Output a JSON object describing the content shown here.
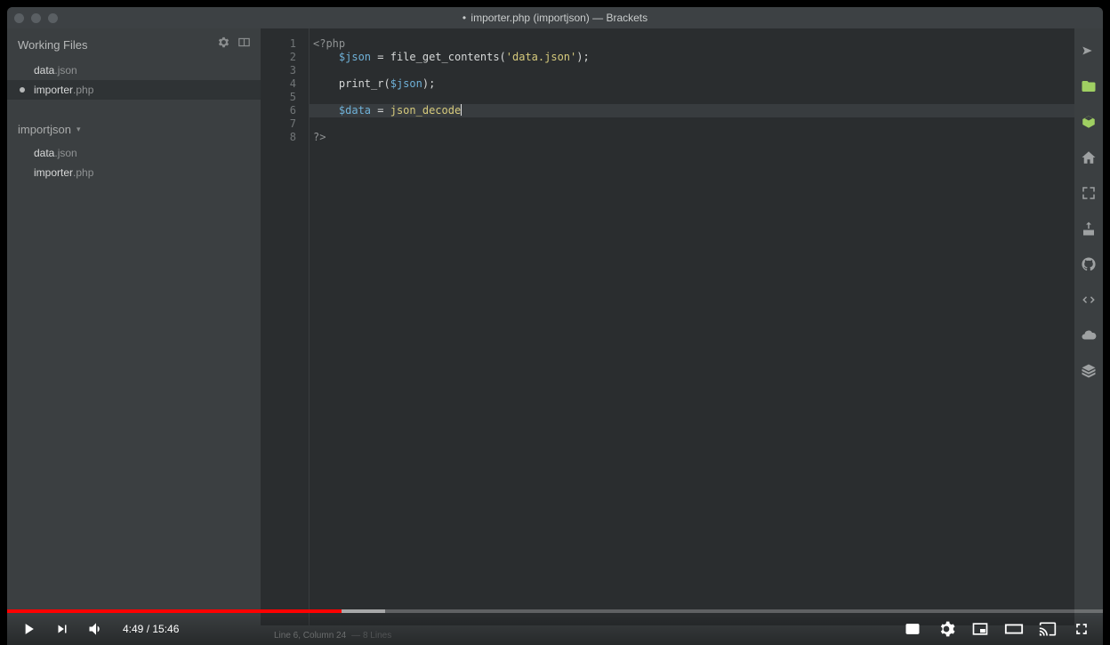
{
  "window": {
    "title_prefix": "•",
    "title": "importer.php (importjson) — Brackets"
  },
  "sidebar": {
    "working_files_label": "Working Files",
    "working_files": [
      {
        "base": "data",
        "ext": ".json",
        "dirty": false,
        "active": false
      },
      {
        "base": "importer",
        "ext": ".php",
        "dirty": true,
        "active": true
      }
    ],
    "project_name": "importjson",
    "project_files": [
      {
        "base": "data",
        "ext": ".json"
      },
      {
        "base": "importer",
        "ext": ".php"
      }
    ]
  },
  "editor": {
    "line_numbers": [
      "1",
      "2",
      "3",
      "4",
      "5",
      "6",
      "7",
      "8"
    ],
    "current_line_index": 5,
    "lines": [
      [
        {
          "c": "tok-tag",
          "t": "<?php"
        }
      ],
      [
        {
          "c": "",
          "t": "    "
        },
        {
          "c": "tok-var",
          "t": "$json"
        },
        {
          "c": "tok-op",
          "t": " = "
        },
        {
          "c": "tok-fn",
          "t": "file_get_contents"
        },
        {
          "c": "tok-op",
          "t": "("
        },
        {
          "c": "tok-str",
          "t": "'data.json'"
        },
        {
          "c": "tok-op",
          "t": ");"
        }
      ],
      [
        {
          "c": "",
          "t": ""
        }
      ],
      [
        {
          "c": "",
          "t": "    "
        },
        {
          "c": "tok-fn",
          "t": "print_r"
        },
        {
          "c": "tok-op",
          "t": "("
        },
        {
          "c": "tok-var",
          "t": "$json"
        },
        {
          "c": "tok-op",
          "t": ");"
        }
      ],
      [
        {
          "c": "",
          "t": ""
        }
      ],
      [
        {
          "c": "",
          "t": "    "
        },
        {
          "c": "tok-var",
          "t": "$data"
        },
        {
          "c": "tok-op",
          "t": " = "
        },
        {
          "c": "tok-kw",
          "t": "json_decode"
        },
        {
          "c": "cursor",
          "t": ""
        }
      ],
      [
        {
          "c": "",
          "t": ""
        }
      ],
      [
        {
          "c": "tok-tag",
          "t": "?>"
        }
      ]
    ]
  },
  "status": {
    "pos": "Line 6, Column 24",
    "lines": "— 8 Lines"
  },
  "video": {
    "current": "4:49",
    "sep": " / ",
    "total": "15:46"
  },
  "right_rail": [
    "bolt",
    "folder",
    "box",
    "home",
    "fullscreen",
    "extract",
    "github",
    "code",
    "cloud",
    "stack"
  ]
}
